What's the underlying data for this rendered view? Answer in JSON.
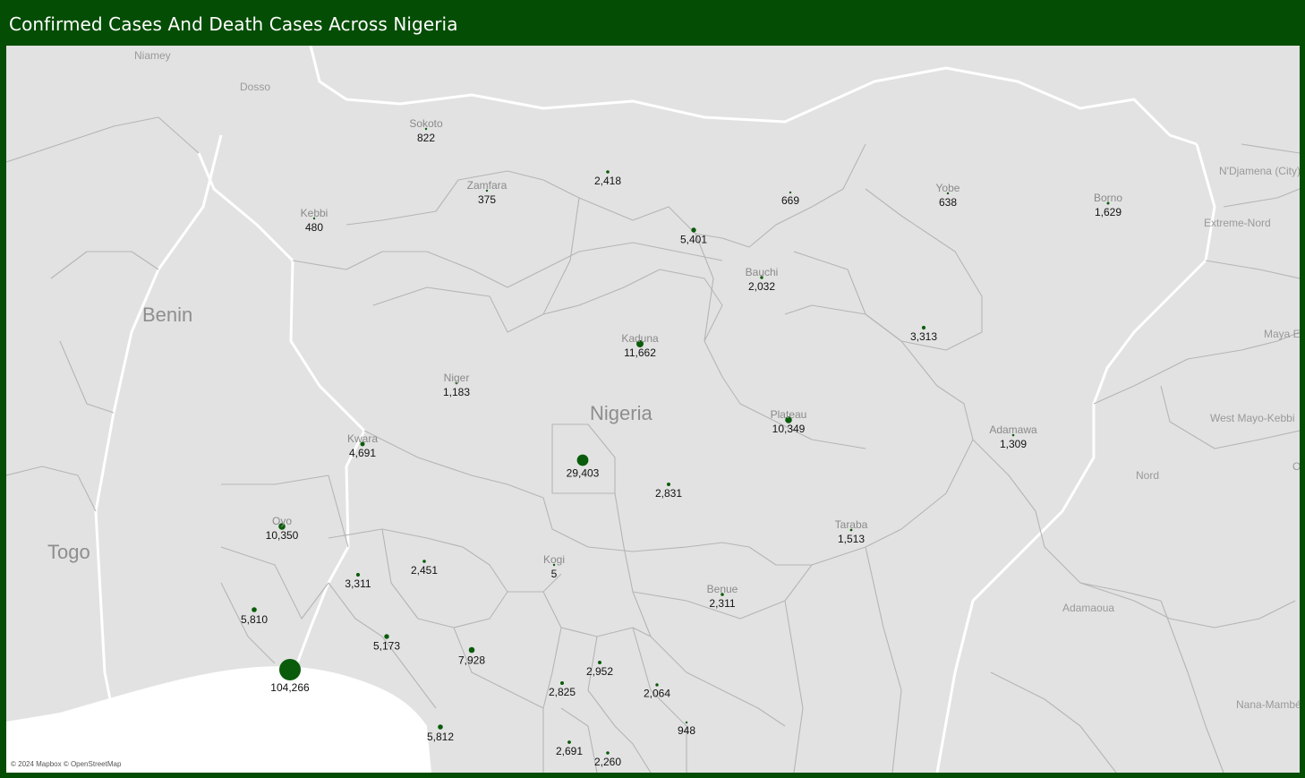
{
  "title": "Confirmed Cases And Death Cases Across Nigeria",
  "attribution": "© 2024 Mapbox © OpenStreetMap",
  "colors": {
    "header": "#044d04",
    "marker": "#0a5c0a",
    "land": "#e2e2e2",
    "water": "#ffffff",
    "border": "#ffffff",
    "place_label": "#8a8a8a",
    "value_label": "#111111"
  },
  "country_labels": [
    "Nigeria",
    "Benin",
    "Togo"
  ],
  "place_labels": [
    "Niamey",
    "Dosso",
    "N'Djamena (City)",
    "Extreme-Nord",
    "Maya Est (",
    "West Mayo-Kebbi",
    "Nord",
    "Adamaoua",
    "Nana-Mambéré",
    "O ("
  ],
  "states": [
    {
      "name": "Sokoto",
      "value": "822",
      "cases": 822
    },
    {
      "name": "Zamfara",
      "value": "375",
      "cases": 375
    },
    {
      "name": "Kebbi",
      "value": "480",
      "cases": 480
    },
    {
      "name": "",
      "value": "2,418",
      "cases": 2418
    },
    {
      "name": "",
      "value": "669",
      "cases": 669
    },
    {
      "name": "",
      "value": "5,401",
      "cases": 5401
    },
    {
      "name": "Yobe",
      "value": "638",
      "cases": 638
    },
    {
      "name": "Borno",
      "value": "1,629",
      "cases": 1629
    },
    {
      "name": "Bauchi",
      "value": "2,032",
      "cases": 2032
    },
    {
      "name": "",
      "value": "3,313",
      "cases": 3313
    },
    {
      "name": "Kaduna",
      "value": "11,662",
      "cases": 11662
    },
    {
      "name": "Niger",
      "value": "1,183",
      "cases": 1183
    },
    {
      "name": "Plateau",
      "value": "10,349",
      "cases": 10349
    },
    {
      "name": "Adamawa",
      "value": "1,309",
      "cases": 1309
    },
    {
      "name": "Kwara",
      "value": "4,691",
      "cases": 4691
    },
    {
      "name": "",
      "value": "29,403",
      "cases": 29403
    },
    {
      "name": "",
      "value": "2,831",
      "cases": 2831
    },
    {
      "name": "Taraba",
      "value": "1,513",
      "cases": 1513
    },
    {
      "name": "Oyo",
      "value": "10,350",
      "cases": 10350
    },
    {
      "name": "",
      "value": "2,451",
      "cases": 2451
    },
    {
      "name": "",
      "value": "3,311",
      "cases": 3311
    },
    {
      "name": "Kogi",
      "value": "5",
      "cases": 5
    },
    {
      "name": "Benue",
      "value": "2,311",
      "cases": 2311
    },
    {
      "name": "",
      "value": "5,810",
      "cases": 5810
    },
    {
      "name": "",
      "value": "5,173",
      "cases": 5173
    },
    {
      "name": "",
      "value": "7,928",
      "cases": 7928
    },
    {
      "name": "",
      "value": "104,266",
      "cases": 104266
    },
    {
      "name": "",
      "value": "2,952",
      "cases": 2952
    },
    {
      "name": "",
      "value": "2,825",
      "cases": 2825
    },
    {
      "name": "",
      "value": "2,064",
      "cases": 2064
    },
    {
      "name": "",
      "value": "5,812",
      "cases": 5812
    },
    {
      "name": "",
      "value": "948",
      "cases": 948
    },
    {
      "name": "",
      "value": "2,691",
      "cases": 2691
    },
    {
      "name": "",
      "value": "2,260",
      "cases": 2260
    }
  ]
}
